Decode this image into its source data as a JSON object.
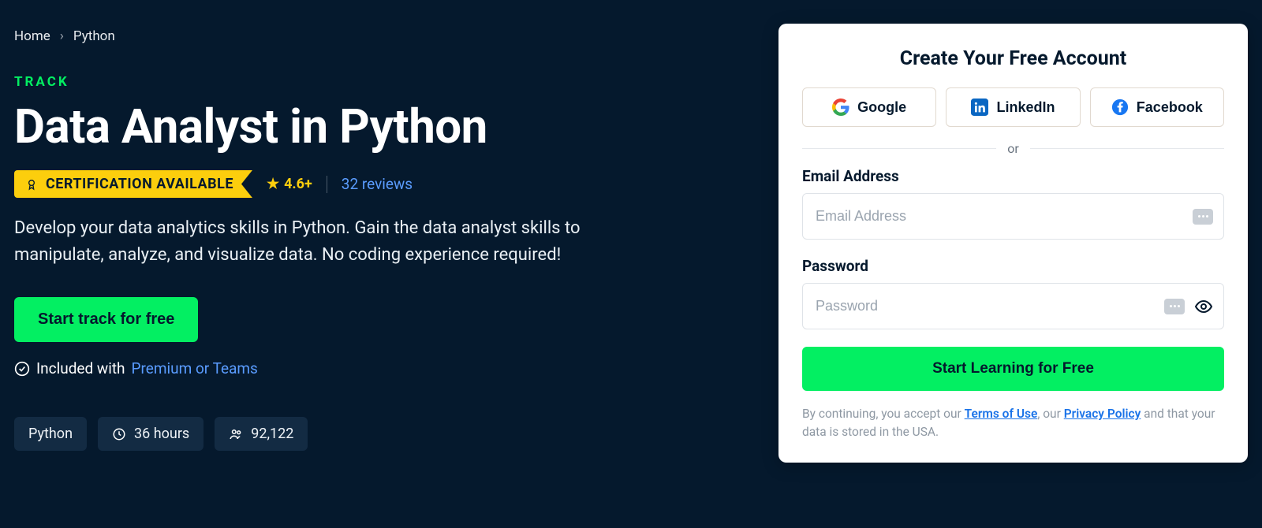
{
  "breadcrumb": {
    "home": "Home",
    "python": "Python"
  },
  "track": {
    "eyebrow": "TRACK",
    "title": "Data Analyst in Python",
    "certification_label": "CERTIFICATION AVAILABLE",
    "rating": "4.6+",
    "reviews_link": "32 reviews",
    "description": "Develop your data analytics skills in Python. Gain the data analyst skills to manipulate, analyze, and visualize data. No coding experience required!",
    "cta": "Start track for free",
    "included_prefix": "Included with",
    "included_link": "Premium or Teams",
    "chips": {
      "tech": "Python",
      "duration": "36 hours",
      "learners": "92,122"
    }
  },
  "signup": {
    "title": "Create Your Free Account",
    "social": {
      "google": "Google",
      "linkedin": "LinkedIn",
      "facebook": "Facebook"
    },
    "or": "or",
    "email_label": "Email Address",
    "email_placeholder": "Email Address",
    "password_label": "Password",
    "password_placeholder": "Password",
    "submit": "Start Learning for Free",
    "legal_prefix": "By continuing, you accept our ",
    "terms": "Terms of Use",
    "legal_mid": ", our ",
    "privacy": "Privacy Policy",
    "legal_suffix": " and that your data is stored in the USA."
  }
}
